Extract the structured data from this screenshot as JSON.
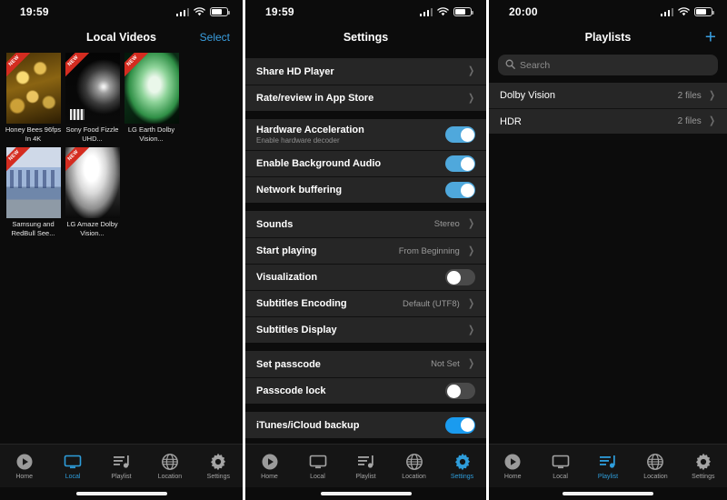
{
  "colors": {
    "accent": "#3a9fe0",
    "tab_active": "#2e9ddb",
    "switch_on": "#4fa8dc",
    "switch_on_bright": "#1a9bef",
    "switch_off": "#4a4a4a",
    "row_bg": "#262626",
    "screen_bg": "#0c0c0c",
    "badge_red": "#d42c20"
  },
  "tabs": {
    "home": "Home",
    "local": "Local",
    "playlist": "Playlist",
    "location": "Location",
    "settings": "Settings"
  },
  "local": {
    "status": {
      "time": "19:59"
    },
    "nav": {
      "title": "Local Videos",
      "action": "Select"
    },
    "videos": [
      {
        "label": "Honey Bees 96fps In 4K",
        "badge": "NEW",
        "art": "art-honey"
      },
      {
        "label": "Sony Food Fizzle UHD...",
        "badge": "NEW",
        "art": "art-sony"
      },
      {
        "label": "LG Earth Dolby Vision...",
        "badge": "NEW",
        "art": "art-lg"
      },
      {
        "label": "Samsung and RedBull See...",
        "badge": "NEW",
        "art": "art-samsung"
      },
      {
        "label": "LG Amaze Dolby Vision...",
        "badge": "NEW",
        "art": "art-amaze"
      }
    ],
    "active_tab": "local"
  },
  "settings": {
    "status": {
      "time": "19:59"
    },
    "nav": {
      "title": "Settings"
    },
    "groups": [
      {
        "rows": [
          {
            "title": "Share HD Player",
            "type": "link"
          },
          {
            "title": "Rate/review in App Store",
            "type": "link"
          }
        ]
      },
      {
        "rows": [
          {
            "title": "Hardware Acceleration",
            "subtitle": "Enable hardware decoder",
            "type": "switch",
            "value": "on"
          },
          {
            "title": "Enable Background Audio",
            "type": "switch",
            "value": "on"
          },
          {
            "title": "Network buffering",
            "type": "switch",
            "value": "on"
          }
        ]
      },
      {
        "rows": [
          {
            "title": "Sounds",
            "type": "value",
            "value": "Stereo"
          },
          {
            "title": "Start playing",
            "type": "value",
            "value": "From Beginning"
          },
          {
            "title": "Visualization",
            "type": "switch",
            "value": "off"
          },
          {
            "title": "Subtitles Encoding",
            "type": "value",
            "value": "Default (UTF8)"
          },
          {
            "title": "Subtitles Display",
            "type": "link"
          }
        ]
      },
      {
        "rows": [
          {
            "title": "Set passcode",
            "type": "value",
            "value": "Not Set"
          },
          {
            "title": "Passcode lock",
            "type": "switch",
            "value": "off"
          }
        ]
      },
      {
        "rows": [
          {
            "title": "iTunes/iCloud backup",
            "type": "switch",
            "value": "on-bright"
          }
        ]
      }
    ],
    "active_tab": "settings"
  },
  "playlists": {
    "status": {
      "time": "20:00"
    },
    "nav": {
      "title": "Playlists",
      "add": "+"
    },
    "search": {
      "placeholder": "Search",
      "value": ""
    },
    "items": [
      {
        "name": "Dolby Vision",
        "count": "2 files"
      },
      {
        "name": "HDR",
        "count": "2 files"
      }
    ],
    "active_tab": "playlist"
  }
}
